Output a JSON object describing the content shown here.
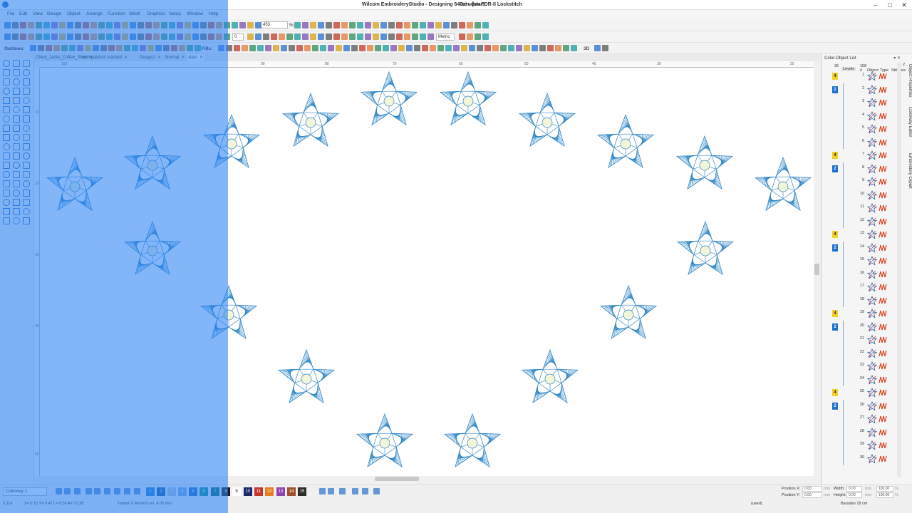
{
  "window": {
    "title": "Wilcom EmbroideryStudio - Designing 64-bit - [stars",
    "machine": "Barudan FDR-II Lockstitch",
    "controls": [
      "–",
      "□",
      "✕"
    ]
  },
  "menu": [
    "File",
    "Edit",
    "View",
    "Design",
    "Object",
    "Arrange",
    "Function",
    "Stitch",
    "Graphics",
    "Setup",
    "Window",
    "Help"
  ],
  "toolbar": {
    "zoom_value": "453",
    "zoom_unit": "%",
    "angle_value": "0",
    "units_value": "Metric",
    "outlines_label": "Outlines:",
    "fills_label": "Fills:",
    "view_3d_label": "3D"
  },
  "doc_tabs": [
    {
      "label": "Chest_Jacks_Coffee_Shop",
      "active": false
    },
    {
      "label": "swimpatches stacked",
      "active": false
    },
    {
      "label": "Design1",
      "active": false
    },
    {
      "label": "Normal",
      "active": false
    },
    {
      "label": "stars",
      "active": true
    }
  ],
  "ruler": {
    "h_ticks": [
      "100",
      "90",
      "80",
      "70",
      "60",
      "50",
      "40",
      "30",
      "20"
    ],
    "v_ticks": [
      "10",
      "20",
      "30",
      "40",
      "50"
    ]
  },
  "right_panel": {
    "title": "Color-Object List",
    "buttons": "▾ ✕",
    "header_num": "36",
    "header_count": "108",
    "header_levels": "Levels",
    "col_hash": "#",
    "col_object": "Object",
    "col_type": "Type",
    "col_stitches": "Stitches",
    "col_stitches_value": "2",
    "rows": [
      "1",
      "2",
      "3",
      "4",
      "5",
      "6",
      "7",
      "8",
      "9",
      "10",
      "11",
      "12",
      "13",
      "14",
      "15",
      "16",
      "17",
      "18",
      "19",
      "20",
      "21",
      "22",
      "23",
      "24",
      "25",
      "26",
      "27",
      "28",
      "29",
      "30"
    ],
    "badge_yellow": "4",
    "badge_blue": "2",
    "side_tabs": [
      "Object Properties",
      "Colorway Editor",
      "Embroidery Clipart"
    ]
  },
  "bottom": {
    "colorway": "Colorway 1",
    "swatches": [
      {
        "num": "1",
        "color": "#2b7fd4"
      },
      {
        "num": "2",
        "color": "#1d5fa8"
      },
      {
        "num": "3",
        "color": "#b0c4de"
      },
      {
        "num": "4",
        "color": "#7fb0e6"
      },
      {
        "num": "5",
        "color": "#2f6fc0"
      },
      {
        "num": "6",
        "color": "#1c8f8f"
      },
      {
        "num": "7",
        "color": "#0f6f6f"
      },
      {
        "num": "8",
        "color": "#1a1a1a"
      },
      {
        "num": "9",
        "color": "#ffffff"
      },
      {
        "num": "10",
        "color": "#1a2a6c"
      },
      {
        "num": "11",
        "color": "#c0392b"
      },
      {
        "num": "12",
        "color": "#e67e22"
      },
      {
        "num": "13",
        "color": "#8e44ad"
      },
      {
        "num": "14",
        "color": "#a0522d"
      },
      {
        "num": "15",
        "color": "#2c2c2c"
      }
    ],
    "position_x_label": "Position X:",
    "position_y_label": "Position Y:",
    "position_x": "0.00",
    "position_y": "0.00",
    "unit": "mm",
    "width_label": "Width:",
    "height_label": "Height:",
    "width": "0.00",
    "height": "0.00",
    "scale_w": "100.00",
    "scale_h": "100.00",
    "percent": "%"
  },
  "status": {
    "coords": "3.114",
    "xy": "X= 0.15 Y= 0.47 L= 0.50 A= 72.38",
    "object_info": "Tatami: 0.40 mm Len: 4.00 mm",
    "used": "(used)",
    "hoop": "Barudan 18 cm"
  },
  "colors": {
    "stitch_blue": "#2f86c6",
    "star_center": "#f2f6d8",
    "overlay": "#2882f5",
    "yellow_badge": "#f2d026",
    "blue_badge": "#1f6fd1"
  }
}
